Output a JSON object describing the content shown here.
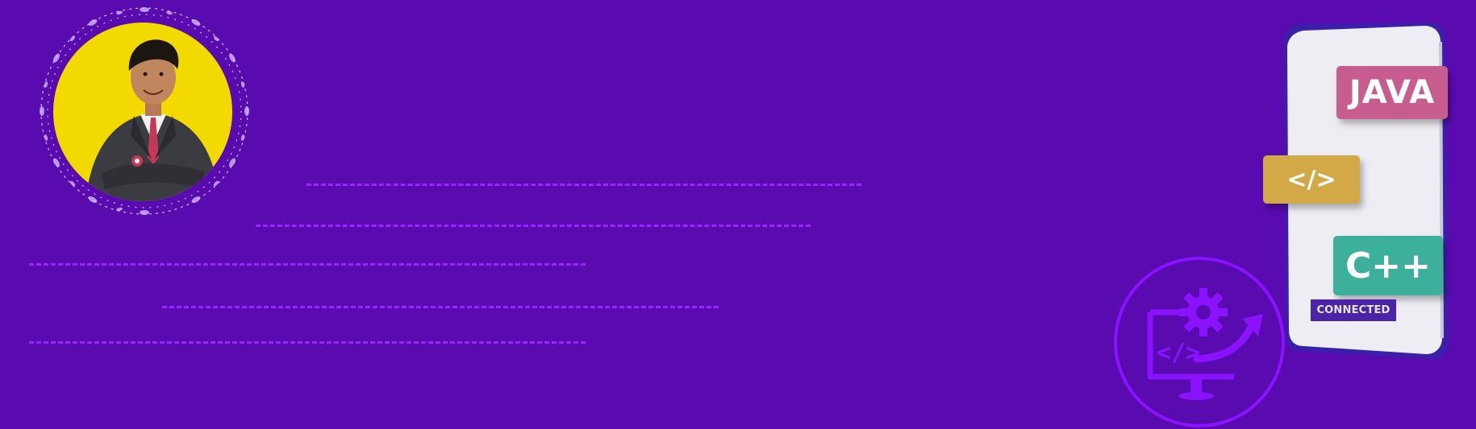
{
  "colors": {
    "background": "#5a0bb0",
    "dash": "#9b24ff",
    "portrait_bg": "#f2da00",
    "java_tag": "#c75c8e",
    "code_tag": "#d2a946",
    "cpp_tag": "#3db09b",
    "connected_badge": "#4a23a6",
    "icon_outline": "#8a12ff"
  },
  "portrait": {
    "icon": "person-portrait"
  },
  "placeholder_lines": {
    "count": 5,
    "style": "dashed"
  },
  "dev_icon": {
    "icon": "code-monitor-gear-icon",
    "code_glyph": "</>"
  },
  "phone": {
    "tags": {
      "java": "JAVA",
      "code": "</>",
      "cpp": "C++"
    },
    "status": "CONNECTED"
  }
}
